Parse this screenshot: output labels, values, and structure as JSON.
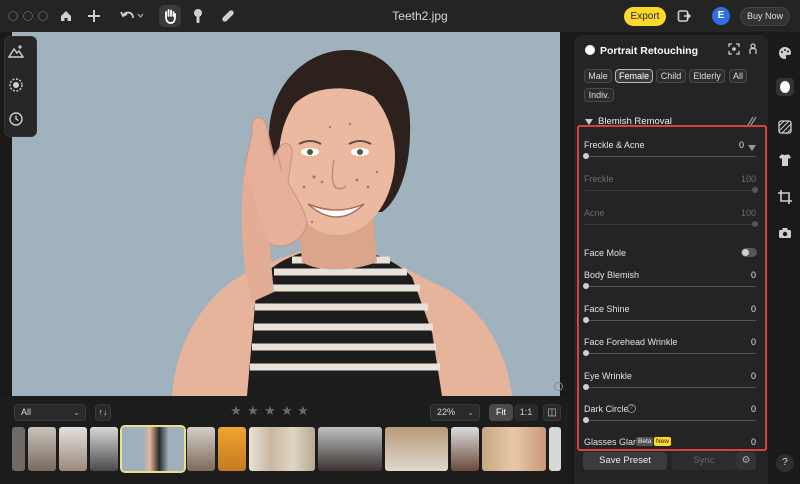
{
  "window": {
    "title": "Teeth2.jpg"
  },
  "toolbar": {
    "export_label": "Export",
    "avatar_letter": "E",
    "buy_now_label": "Buy Now"
  },
  "filmstrip": {
    "filter_value": "All",
    "sort_glyph": "↑↓",
    "rating_stars": 5,
    "zoom_value": "22%",
    "fit_label": "Fit",
    "one_to_one_label": "1:1"
  },
  "panel": {
    "title": "Portrait Retouching",
    "chips": [
      "Male",
      "Female",
      "Child",
      "Elderly",
      "All",
      "Indiv."
    ],
    "selected_chip": "Female",
    "section_title": "Blemish Removal",
    "sliders": [
      {
        "label": "Freckle & Acne",
        "value": "0",
        "dim": false
      },
      {
        "label": "Freckle",
        "value": "100",
        "dim": true
      },
      {
        "label": "Acne",
        "value": "100",
        "dim": true
      },
      {
        "label": "Face Mole",
        "value": "",
        "dim": false
      },
      {
        "label": "Body Blemish",
        "value": "0",
        "dim": false
      },
      {
        "label": "Face Shine",
        "value": "0",
        "dim": false
      },
      {
        "label": "Face Forehead Wrinkle",
        "value": "0",
        "dim": false
      },
      {
        "label": "Eye Wrinkle",
        "value": "0",
        "dim": false
      },
      {
        "label": "Dark Circle",
        "value": "0",
        "dim": false
      },
      {
        "label": "Glasses Glare",
        "value": "0",
        "dim": false
      }
    ],
    "beta_badge": "Beta",
    "new_badge": "New",
    "save_preset_label": "Save Preset",
    "sync_label": "Sync"
  },
  "help_label": "?",
  "colors": {
    "accent_export": "#ffd82c",
    "highlight_box": "#d94040",
    "avatar": "#2f6fe0"
  }
}
